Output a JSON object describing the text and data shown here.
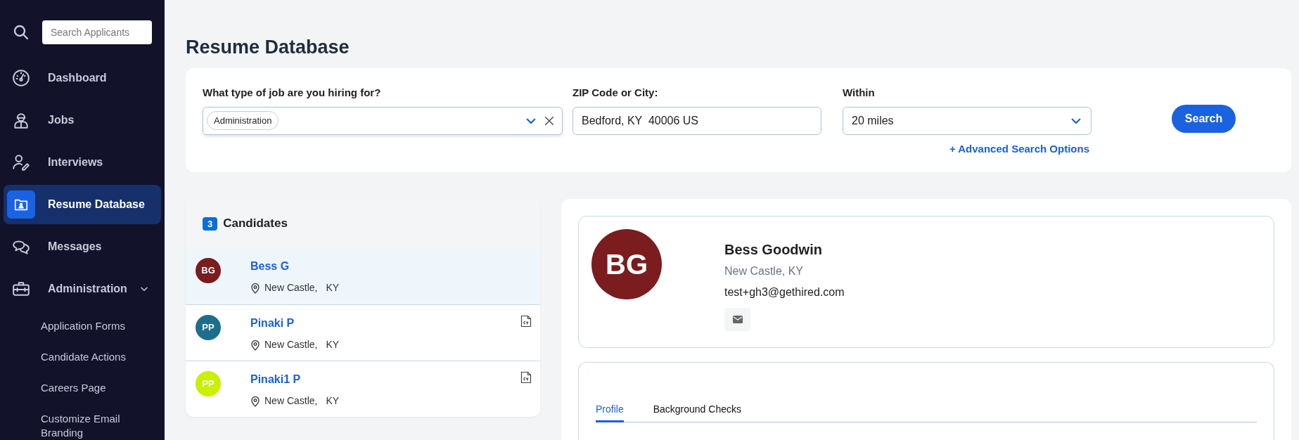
{
  "sidebar": {
    "search": {
      "placeholder": "Search Applicants"
    },
    "items": [
      {
        "kind": "dashboard",
        "label": "Dashboard",
        "selected": false
      },
      {
        "kind": "jobs",
        "label": "Jobs",
        "selected": false
      },
      {
        "kind": "interviews",
        "label": "Interviews",
        "selected": false
      },
      {
        "kind": "resume",
        "label": "Resume Database",
        "selected": true
      },
      {
        "kind": "messages",
        "label": "Messages",
        "selected": false
      },
      {
        "kind": "admin",
        "label": "Administration",
        "selected": false,
        "expanded": true,
        "children": [
          {
            "label": "Application Forms"
          },
          {
            "label": "Candidate Actions"
          },
          {
            "label": "Careers Page"
          },
          {
            "label": "Customize Email Branding"
          }
        ]
      }
    ]
  },
  "page_title": "Resume Database",
  "search_form": {
    "job_type": {
      "label": "What type of job are you hiring for?",
      "tags": [
        "Administration"
      ]
    },
    "location": {
      "label": "ZIP Code or City:",
      "value": "Bedford, KY  40006 US"
    },
    "within": {
      "label": "Within",
      "value": "20 miles"
    },
    "advanced_link": "+ Advanced Search Options",
    "search_button": "Search"
  },
  "candidates": {
    "count": "3",
    "title": "Candidates",
    "items": [
      {
        "initials": "BG",
        "name": "Bess G",
        "city": "New Castle,",
        "state": "KY",
        "color": "#7b1c1f",
        "has_cv": false,
        "selected": true
      },
      {
        "initials": "PP",
        "name": "Pinaki P",
        "city": "New Castle,",
        "state": "KY",
        "color": "#1d6e8a",
        "has_cv": true,
        "selected": false
      },
      {
        "initials": "PP",
        "name": "Pinaki1 P",
        "city": "New Castle,",
        "state": "KY",
        "color": "#c8f000",
        "has_cv": true,
        "selected": false
      }
    ]
  },
  "detail": {
    "initials": "BG",
    "color": "#7b1c1f",
    "name": "Bess Goodwin",
    "location": "New Castle, KY",
    "email": "test+gh3@gethired.com",
    "tabs": [
      {
        "label": "Profile",
        "selected": true
      },
      {
        "label": "Background Checks",
        "selected": false
      }
    ]
  }
}
